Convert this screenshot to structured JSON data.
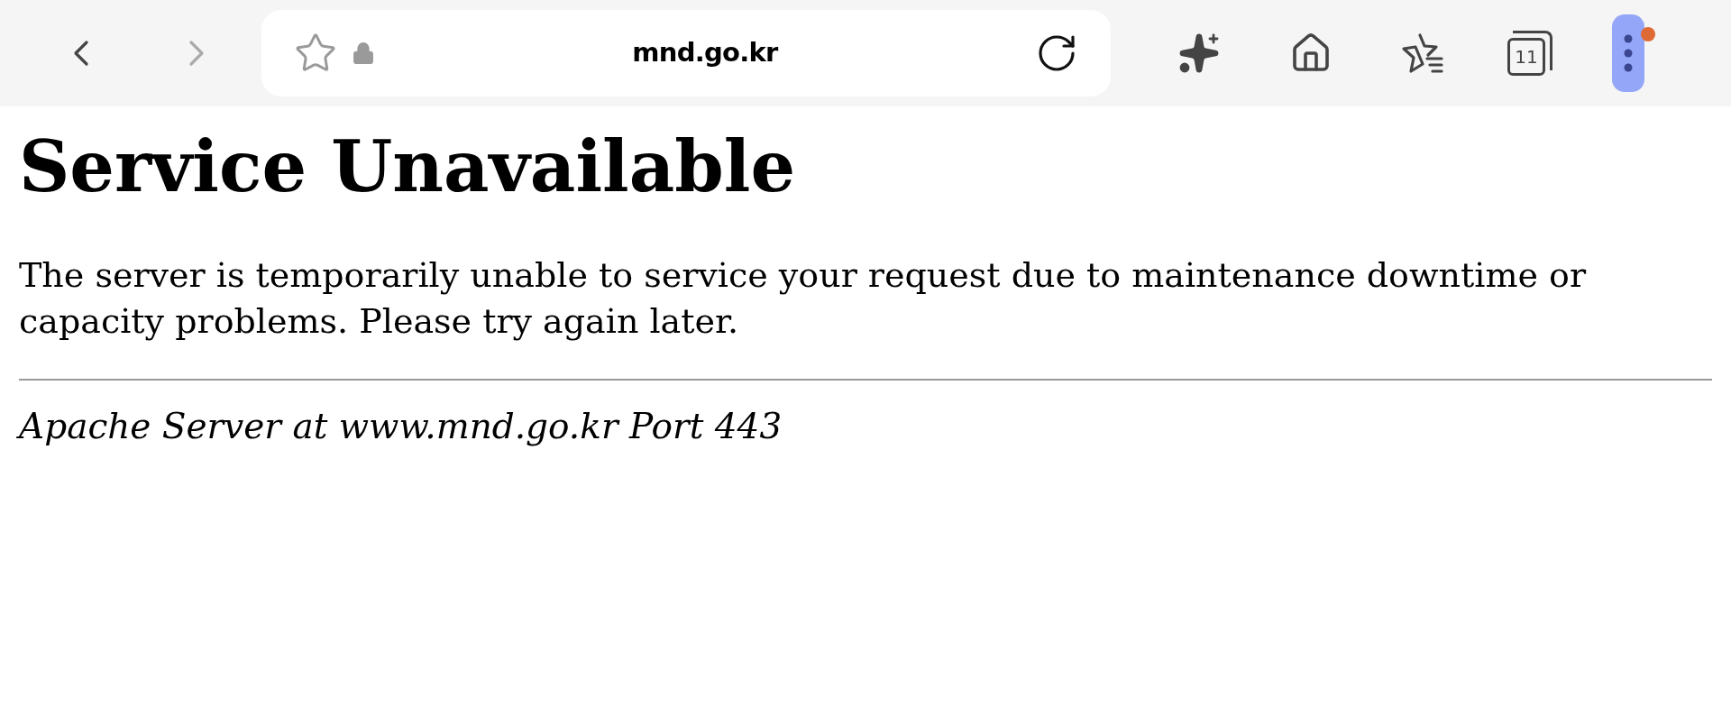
{
  "toolbar": {
    "url": "mnd.go.kr",
    "tab_count": "11",
    "menu_notification": true
  },
  "page": {
    "title": "Service Unavailable",
    "message": "The server is temporarily unable to service your request due to maintenance downtime or capacity problems. Please try again later.",
    "address": "Apache Server at www.mnd.go.kr Port 443"
  }
}
